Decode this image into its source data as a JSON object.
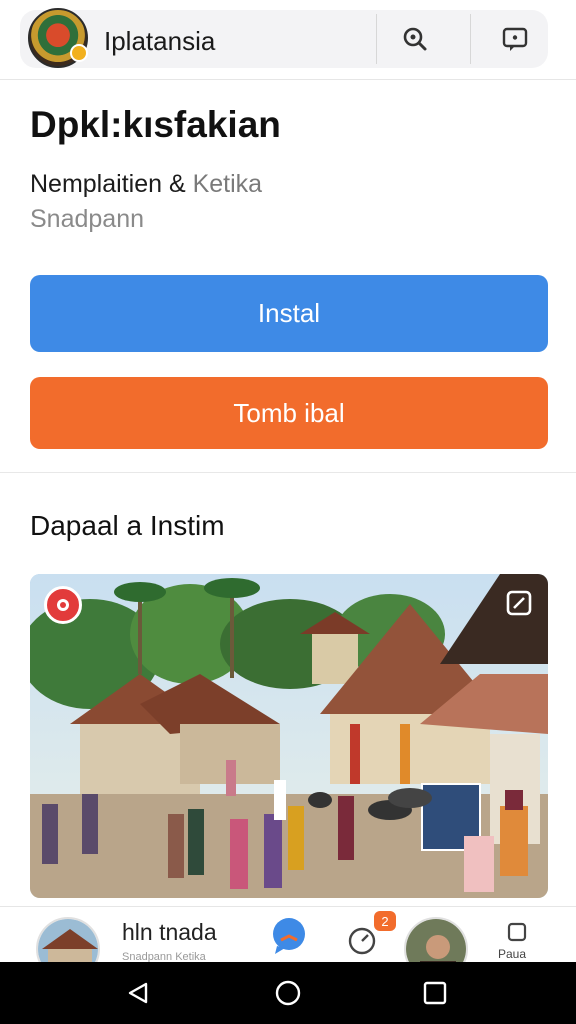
{
  "appbar": {
    "title": "Iplatansia",
    "logo_icon": "app-logo",
    "search_icon": "search-icon",
    "message_icon": "message-icon"
  },
  "header": {
    "title": "Dpkl:kısfakian",
    "subtitle_main": "Nemplaitien & ",
    "subtitle_muted": "Ketika",
    "subtitle_line2": "Snadpann"
  },
  "buttons": {
    "install_label": "Instal",
    "secondary_label": "Tomb ibal"
  },
  "section": {
    "title": "Dapaal a Instim"
  },
  "photo": {
    "badge_icon": "record-icon",
    "expand_icon": "expand-icon"
  },
  "bottom_nav": {
    "label": "hln tnada",
    "sublabel": "Snadpann Ketika",
    "badge_count": "2",
    "end_label": "Paua"
  },
  "system_nav": {
    "back_icon": "back-triangle-icon",
    "home_icon": "home-circle-icon",
    "recents_icon": "recents-square-icon"
  },
  "colors": {
    "install_blue": "#3e8ae6",
    "secondary_orange": "#f26c2c"
  }
}
